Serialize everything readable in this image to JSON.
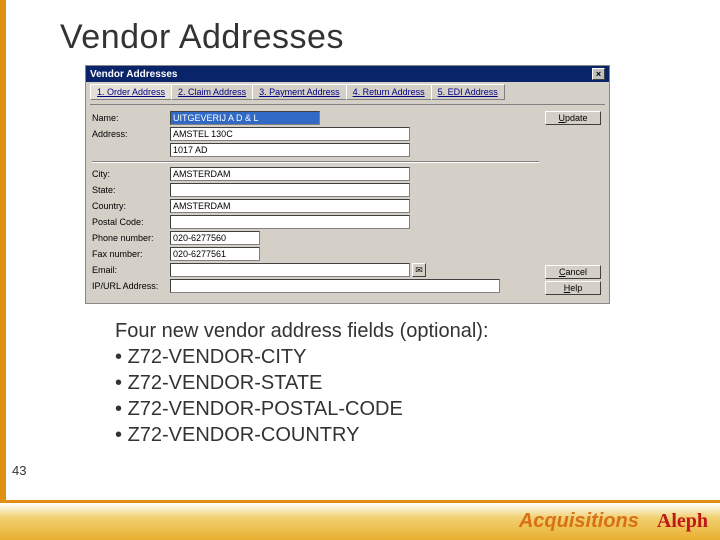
{
  "slide": {
    "title": "Vendor Addresses",
    "page_number": "43",
    "footer_section": "Acquisitions",
    "logo_text": "Aleph"
  },
  "body": {
    "intro": "Four new vendor address fields (optional):",
    "bullets": [
      "Z72-VENDOR-CITY",
      "Z72-VENDOR-STATE",
      "Z72-VENDOR-POSTAL-CODE",
      "Z72-VENDOR-COUNTRY"
    ]
  },
  "window": {
    "title": "Vendor Addresses",
    "tabs": [
      "1. Order Address",
      "2. Claim Address",
      "3. Payment Address",
      "4. Return Address",
      "5. EDI Address"
    ],
    "buttons": {
      "update": "Update",
      "cancel": "Cancel",
      "help": "Help"
    },
    "fields": {
      "name": {
        "label": "Name:",
        "value": "UITGEVERIJ A D & L"
      },
      "address1": {
        "label": "Address:",
        "value": "AMSTEL 130C"
      },
      "address2": {
        "value": "1017 AD"
      },
      "city": {
        "label": "City:",
        "value": "AMSTERDAM"
      },
      "state": {
        "label": "State:",
        "value": ""
      },
      "country": {
        "label": "Country:",
        "value": "AMSTERDAM"
      },
      "postal": {
        "label": "Postal Code:",
        "value": ""
      },
      "phone": {
        "label": "Phone number:",
        "value": "020-6277560"
      },
      "fax": {
        "label": "Fax number:",
        "value": "020-6277561"
      },
      "email": {
        "label": "Email:",
        "value": ""
      },
      "ipurl": {
        "label": "IP/URL Address:",
        "value": ""
      }
    }
  }
}
